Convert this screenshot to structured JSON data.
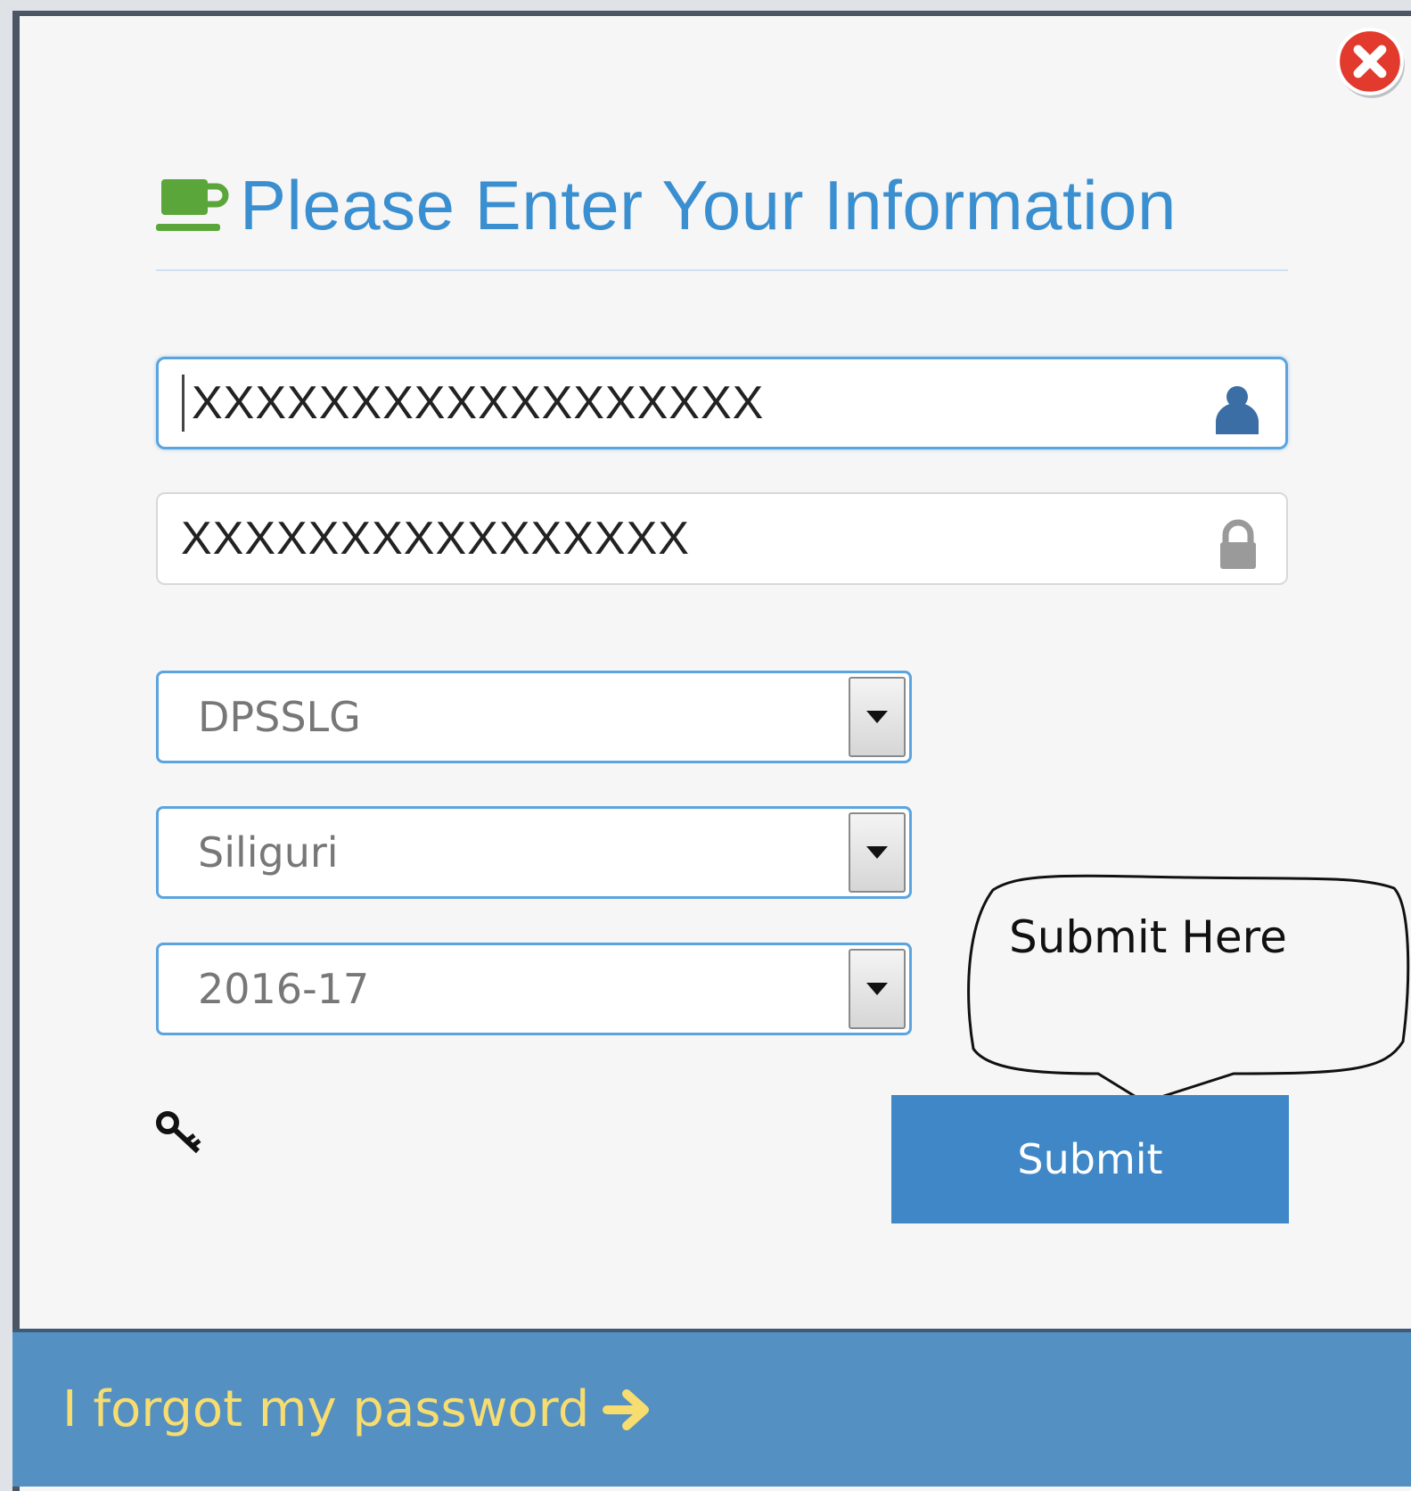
{
  "dialog": {
    "title": "Please Enter Your Information",
    "close_icon": "close-icon"
  },
  "fields": {
    "username": {
      "value": "XXXXXXXXXXXXXXXXXX",
      "icon": "user-icon"
    },
    "password": {
      "value": "XXXXXXXXXXXXXXXX",
      "icon": "lock-icon"
    }
  },
  "selects": {
    "school": {
      "value": "DPSSLG"
    },
    "city": {
      "value": "Siliguri"
    },
    "session": {
      "value": "2016-17"
    }
  },
  "callout": {
    "text": "Submit Here"
  },
  "actions": {
    "submit_label": "Submit",
    "key_icon": "key-icon"
  },
  "footer": {
    "forgot_label": "I forgot my password",
    "arrow_icon": "arrow-right-icon"
  },
  "colors": {
    "title": "#3a8fd0",
    "accent": "#3f87c6",
    "footer": "#5490c2",
    "link": "#f7dc6f",
    "cup": "#5aa63a",
    "close": "#e02b20"
  }
}
